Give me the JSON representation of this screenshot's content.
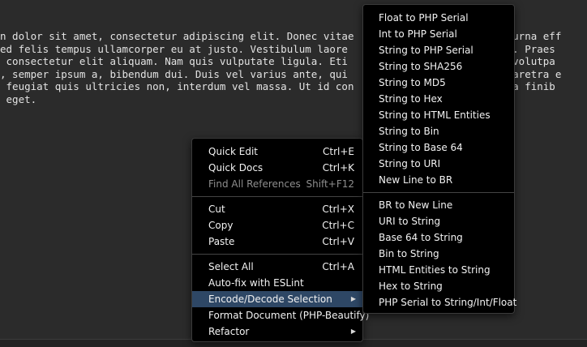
{
  "editor": {
    "lines": [
      "n dolor sit amet, consectetur adipiscing elit. Donec vitae                      iet urna eff",
      "ed felis tempus ullamcorper eu at justo. Vestibulum laore                      idunt. Praes",
      " consectetur elit aliquam. Nam quis vulputate ligula. Eti                       nec volutpa",
      ", semper ipsum a, bibendum dui. Duis vel varius ante, qui                       s pharetra e",
      " feugiat quis ultricies non, interdum vel massa. Ut id con                      Nulla finib",
      " eget."
    ]
  },
  "context_menu": {
    "quick_edit": {
      "label": "Quick Edit",
      "shortcut": "Ctrl+E"
    },
    "quick_docs": {
      "label": "Quick Docs",
      "shortcut": "Ctrl+K"
    },
    "find_all_references": {
      "label": "Find All References",
      "shortcut": "Shift+F12"
    },
    "cut": {
      "label": "Cut",
      "shortcut": "Ctrl+X"
    },
    "copy": {
      "label": "Copy",
      "shortcut": "Ctrl+C"
    },
    "paste": {
      "label": "Paste",
      "shortcut": "Ctrl+V"
    },
    "select_all": {
      "label": "Select All",
      "shortcut": "Ctrl+A"
    },
    "autofix_eslint": {
      "label": "Auto-fix with ESLint"
    },
    "encode_decode": {
      "label": "Encode/Decode Selection",
      "arrow": "▶"
    },
    "format_document": {
      "label": "Format Document (PHP-Beautify)"
    },
    "refactor": {
      "label": "Refactor",
      "arrow": "▶"
    }
  },
  "submenu": {
    "encode_items": [
      "Float to PHP Serial",
      "Int to PHP Serial",
      "String to PHP Serial",
      "String to SHA256",
      "String to MD5",
      "String to Hex",
      "String to HTML Entities",
      "String to Bin",
      "String to Base 64",
      "String to URI",
      "New Line to BR"
    ],
    "decode_items": [
      "BR to New Line",
      "URI to String",
      "Base 64 to String",
      "Bin to String",
      "HTML Entities to String",
      "Hex to String",
      "PHP Serial to String/Int/Float"
    ]
  },
  "colors": {
    "editor_background": "#2b2b2b",
    "menu_background": "#000000",
    "highlight": "#2e4765",
    "disabled_text": "#8e8e8e"
  }
}
